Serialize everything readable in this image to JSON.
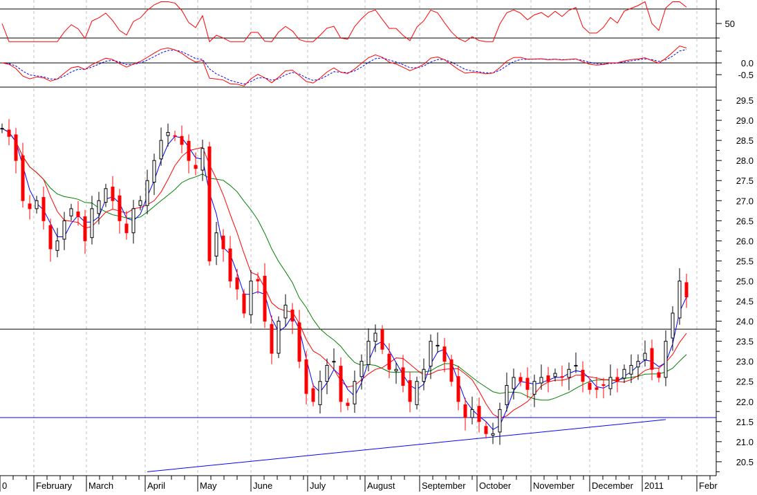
{
  "chart_data": {
    "type": "candlestick",
    "title": "",
    "xlabel": "",
    "ylabel": "",
    "x_tick_labels": [
      "0",
      "February",
      "March",
      "April",
      "May",
      "June",
      "July",
      "August",
      "September",
      "October",
      "November",
      "December",
      "2011",
      "Febr"
    ],
    "price_ylim": [
      20.2,
      29.8
    ],
    "price_ticks": [
      "29.5",
      "29.0",
      "28.5",
      "28.0",
      "27.5",
      "27.0",
      "26.5",
      "26.0",
      "25.5",
      "25.0",
      "24.5",
      "24.0",
      "23.5",
      "23.0",
      "22.5",
      "22.0",
      "21.5",
      "21.0",
      "20.5"
    ],
    "rsi_ticks": [
      "50"
    ],
    "rsi_levels": [
      70,
      30
    ],
    "macd_ticks": [
      "0.0",
      "-0.5"
    ],
    "closes": [
      28.8,
      28.6,
      28.0,
      27.0,
      26.8,
      27.0,
      26.5,
      25.8,
      26.0,
      26.5,
      26.8,
      26.6,
      26.0,
      26.8,
      27.0,
      27.3,
      27.0,
      26.5,
      26.2,
      26.8,
      27.0,
      27.5,
      28.0,
      28.5,
      28.7,
      28.6,
      28.4,
      28.0,
      27.8,
      28.3,
      25.5,
      26.2,
      25.8,
      25.0,
      24.8,
      24.2,
      25.0,
      25.0,
      24.0,
      23.2,
      24.0,
      24.4,
      24.0,
      23.0,
      22.2,
      22.0,
      22.5,
      22.9,
      23.0,
      22.0,
      21.9,
      22.5,
      23.0,
      23.5,
      23.7,
      23.3,
      22.8,
      22.8,
      22.4,
      22.0,
      22.5,
      22.8,
      23.5,
      23.4,
      23.0,
      22.5,
      22.0,
      21.6,
      21.8,
      21.5,
      21.2,
      21.2,
      21.8,
      22.4,
      22.6,
      22.5,
      22.3,
      22.5,
      22.6,
      22.5,
      22.7,
      22.6,
      22.8,
      22.9,
      22.5,
      22.3,
      22.3,
      22.4,
      22.6,
      22.5,
      22.8,
      22.9,
      23.0,
      23.2,
      22.8,
      22.6,
      23.5,
      24.2,
      25.0,
      24.6
    ],
    "moving_averages": [
      {
        "name": "short MA",
        "period": 3,
        "color": "#0000ff"
      },
      {
        "name": "medium MA",
        "period": 7,
        "color": "#ff0000"
      },
      {
        "name": "long MA",
        "period": 14,
        "color": "#008000"
      }
    ],
    "horizontal_lines": [
      {
        "value": 23.8,
        "color": "#000000"
      },
      {
        "value": 21.6,
        "color": "#0000ff"
      }
    ],
    "trendline": {
      "from": [
        21,
        20.25
      ],
      "to": [
        96,
        21.55
      ],
      "color": "#0000ff"
    },
    "colors": {
      "up": "#ffffff",
      "down": "#ff0000",
      "grid": "#c0c0c0"
    }
  }
}
